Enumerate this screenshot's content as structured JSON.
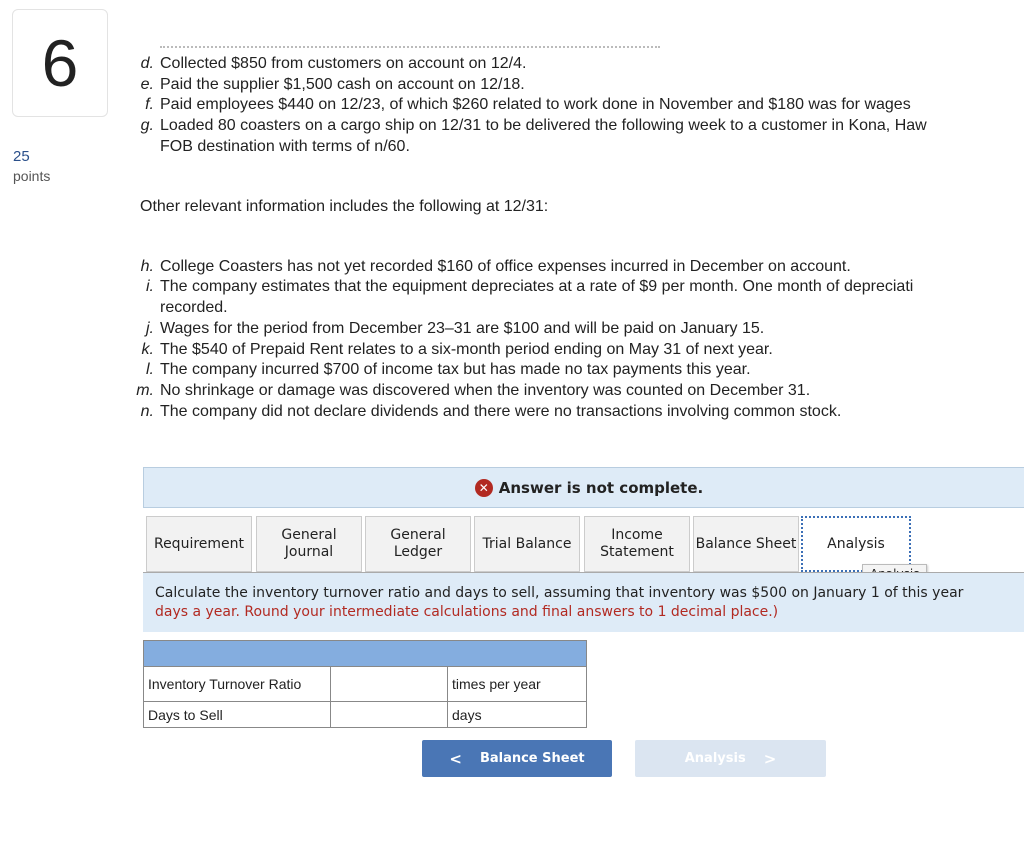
{
  "question": {
    "number": "6",
    "points": "25",
    "points_label": "points"
  },
  "transactions": [
    {
      "letter": "d.",
      "text": "Collected $850 from customers on account on 12/4."
    },
    {
      "letter": "e.",
      "text": "Paid the supplier $1,500 cash on account on 12/18."
    },
    {
      "letter": "f.",
      "text": "Paid employees $440 on 12/23, of which $260 related to work done in November and $180 was for wages"
    },
    {
      "letter": "g.",
      "text": "Loaded 80 coasters on a cargo ship on 12/31 to be delivered the following week to a customer in Kona, Haw"
    },
    {
      "letter": "",
      "text": "FOB destination with terms of n/60."
    }
  ],
  "other_intro": "Other relevant information includes the following at 12/31:",
  "other": [
    {
      "letter": "h.",
      "text": "College Coasters has not yet recorded $160 of office expenses incurred in December on account."
    },
    {
      "letter": "i.",
      "text": "The company estimates that the equipment depreciates at a rate of $9 per month. One month of depreciati"
    },
    {
      "letter": "",
      "text": "recorded."
    },
    {
      "letter": "j.",
      "text": "Wages for the period from December 23–31 are $100 and will be paid on January 15."
    },
    {
      "letter": "k.",
      "text": "The $540 of Prepaid Rent relates to a six-month period ending on May 31 of next year."
    },
    {
      "letter": "l.",
      "text": "The company incurred $700 of income tax but has made no tax payments this year."
    },
    {
      "letter": "m.",
      "text": "No shrinkage or damage was discovered when the inventory was counted on December 31."
    },
    {
      "letter": "n.",
      "text": "The company did not declare dividends and there were no transactions involving common stock."
    }
  ],
  "banner": {
    "text": "Answer is not complete.",
    "icon": "x-circle-icon",
    "color": "#b22a22"
  },
  "tabs": [
    {
      "label": "Requirement"
    },
    {
      "label": "General Journal"
    },
    {
      "label": "General Ledger"
    },
    {
      "label": "Trial Balance"
    },
    {
      "label": "Income Statement"
    },
    {
      "label": "Balance Sheet"
    },
    {
      "label": "Analysis",
      "active": true
    }
  ],
  "tooltip": "Analysis",
  "instructions": {
    "line1": "Calculate the inventory turnover ratio and days to sell, assuming that inventory was $500 on January 1 of this year",
    "line2": "days a year. Round your intermediate calculations and final answers to 1 decimal place.)"
  },
  "table": {
    "rows": [
      {
        "label": "Inventory Turnover Ratio",
        "value": "",
        "unit": "times per year"
      },
      {
        "label": "Days to Sell",
        "value": "",
        "unit": "days"
      }
    ]
  },
  "nav": {
    "prev": "Balance Sheet",
    "next": "Analysis"
  }
}
